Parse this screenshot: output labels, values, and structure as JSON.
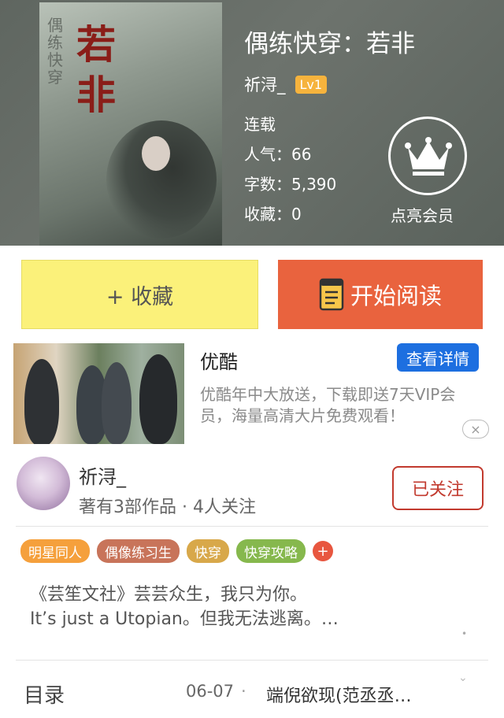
{
  "book": {
    "title": "偶练快穿：若非",
    "author": "祈浔_",
    "level": "Lv1",
    "status": "连载",
    "popularity": "人气：66",
    "word_count": "字数：5,390",
    "favorites": "收藏：0",
    "cover_title": "若非",
    "cover_sub": "偶练快穿"
  },
  "vip": {
    "label": "点亮会员",
    "icon": "crown-icon"
  },
  "actions": {
    "favorite_label": "+ 收藏",
    "read_label": "开始阅读"
  },
  "ad": {
    "title": "优酷",
    "detail_button": "查看详情",
    "description": "优酷年中大放送，下载即送7天VIP会员，海量高清大片免费观看！",
    "close": "×"
  },
  "author_info": {
    "name": "祈浔_",
    "meta": "著有3部作品 · 4人关注",
    "follow_label": "已关注"
  },
  "tags": [
    {
      "label": "明星同人",
      "color": "#f5a03c"
    },
    {
      "label": "偶像练习生",
      "color": "#c8745a"
    },
    {
      "label": "快穿",
      "color": "#d8a84a"
    },
    {
      "label": "快穿攻略",
      "color": "#86b84d"
    }
  ],
  "tag_add": "+",
  "description_lines": [
    "《芸笙文社》芸芸众生，我只为你。",
    "It’s just a Utopian。但我无法逃离。…"
  ],
  "footer": {
    "catalog_label": "目录",
    "date": "06-07",
    "separator": "·",
    "latest_chapter": "端倪欲现(范丞丞…"
  },
  "colors": {
    "favorite_bg": "#fbf17a",
    "read_bg": "#e9633e",
    "follow": "#c23a2e",
    "level_badge": "#f6b33d",
    "ad_button": "#1d6fe0"
  }
}
